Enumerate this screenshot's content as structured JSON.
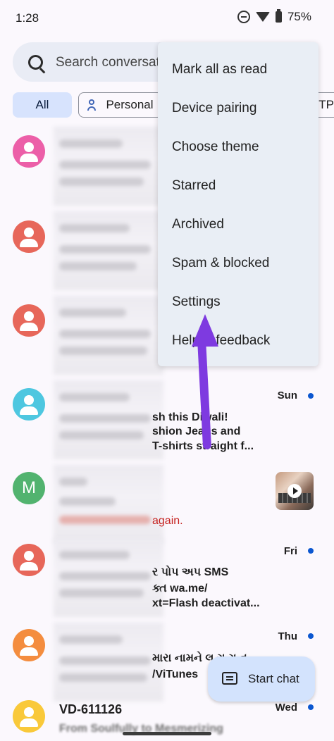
{
  "status": {
    "time": "1:28",
    "battery": "75%"
  },
  "search": {
    "placeholder": "Search conversations",
    "visible_text": "Search conversati"
  },
  "chips": [
    {
      "label": "All",
      "selected": true
    },
    {
      "label": "Personal"
    },
    {
      "label": "OTPs"
    }
  ],
  "menu": {
    "items": [
      "Mark all as read",
      "Device pairing",
      "Choose theme",
      "Starred",
      "Archived",
      "Spam & blocked",
      "Settings",
      "Help & feedback"
    ]
  },
  "conversations": [
    {
      "avatar_color": "#ec5fa8",
      "avatar": "person"
    },
    {
      "avatar_color": "#e7675a",
      "avatar": "person"
    },
    {
      "avatar_color": "#e7675a",
      "avatar": "person"
    },
    {
      "avatar_color": "#4ec7e0",
      "avatar": "person",
      "day": "Sun",
      "unread": true,
      "preview": [
        "sh this Diwali!",
        "shion Jeans and",
        "T-shirts straight f..."
      ]
    },
    {
      "avatar_color": "#52b36f",
      "avatar": "letter",
      "letter": "M",
      "has_thumbnail": true,
      "preview_error": "again."
    },
    {
      "avatar_color": "#e7675a",
      "avatar": "person",
      "day": "Fri",
      "unread": true,
      "preview": [
        "ર પોપ અપ SMS",
        "ક્ત wa.me/",
        "xt=Flash deactivat..."
      ]
    },
    {
      "avatar_color": "#f48d3f",
      "avatar": "person",
      "day": "Thu",
      "unread": true,
      "preview": [
        "મારા નામને લ ગ ગ ત",
        "/ViTunes"
      ]
    },
    {
      "avatar_color": "#f9c93a",
      "avatar": "person",
      "title": "VD-611126",
      "day": "Wed",
      "unread": true,
      "preview": [
        "From Soulfully to Mesmerizing"
      ]
    }
  ],
  "fab": {
    "label": "Start chat"
  },
  "icons": {
    "search": "search-icon",
    "personal": "person-icon",
    "fab": "message-icon",
    "play": "play-icon",
    "annotation": "arrow-up-annotation"
  },
  "colors": {
    "accent": "#0b57d0",
    "arrow": "#7e3ae0",
    "chip_selected": "#d7e3fd",
    "menu_bg": "#e9eef5",
    "error_text": "#c5221f"
  }
}
